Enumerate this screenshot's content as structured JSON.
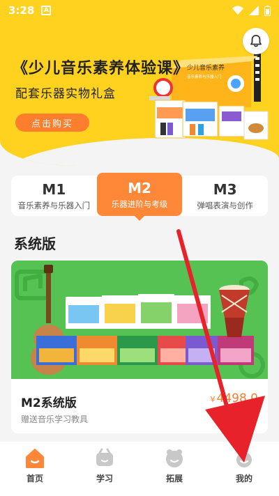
{
  "status_bar": {
    "time": "3:28",
    "notif_letter": "A"
  },
  "header": {
    "title": "《少儿音乐素养体验课》",
    "subtitle": "配套乐器实物礼盒",
    "buy_button": "点击购买",
    "box_title": "少儿音乐素养",
    "box_subtitle": "音乐素养与乐器入门"
  },
  "levels": [
    {
      "code": "M1",
      "desc": "音乐素养与乐器入门",
      "active": false
    },
    {
      "code": "M2",
      "desc": "乐器进阶与考级",
      "active": true
    },
    {
      "code": "M3",
      "desc": "弹唱表演与创作",
      "active": false
    }
  ],
  "section_title": "系统版",
  "product": {
    "name": "M2系统版",
    "currency": "¥",
    "price": "4498.0",
    "gift": "赠送音乐学习教具"
  },
  "bottom_nav": [
    {
      "label": "首页",
      "icon": "house-icon",
      "active": true
    },
    {
      "label": "学习",
      "icon": "learn-icon",
      "active": false
    },
    {
      "label": "拓展",
      "icon": "expand-icon",
      "active": false
    },
    {
      "label": "我的",
      "icon": "profile-icon",
      "active": false
    }
  ],
  "colors": {
    "brand_yellow": "#ffd21f",
    "accent_orange": "#ff8838",
    "card_green": "#55c253",
    "arrow_red": "#e8222a"
  }
}
